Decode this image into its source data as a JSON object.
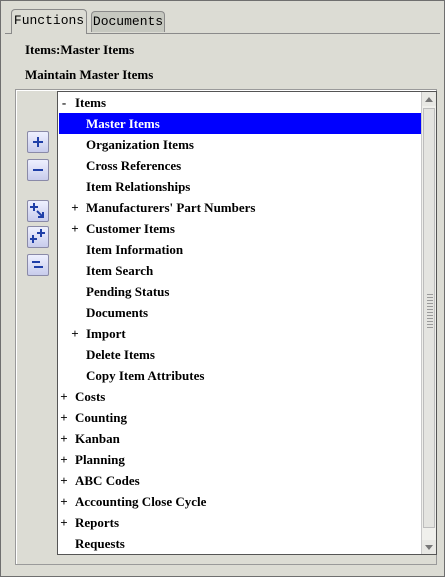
{
  "tabs": [
    {
      "label": "Functions",
      "active": true
    },
    {
      "label": "Documents",
      "active": false
    }
  ],
  "header": {
    "breadcrumb": "Items:Master Items",
    "subtitle": "Maintain Master Items"
  },
  "toolbar": {
    "expand_icon": "plus-icon",
    "collapse_icon": "minus-icon",
    "expand_branch_icon": "expand-branch-icon",
    "expand_all_icon": "expand-all-icon",
    "collapse_all_icon": "collapse-all-icon"
  },
  "tree": {
    "selected_color": "#0000ff",
    "nodes": [
      {
        "level": 0,
        "expander": "-",
        "label": "Items"
      },
      {
        "level": 1,
        "expander": "",
        "label": "Master Items",
        "selected": true
      },
      {
        "level": 1,
        "expander": "",
        "label": "Organization Items"
      },
      {
        "level": 1,
        "expander": "",
        "label": "Cross References"
      },
      {
        "level": 1,
        "expander": "",
        "label": "Item Relationships"
      },
      {
        "level": 1,
        "expander": "+",
        "label": "Manufacturers' Part Numbers"
      },
      {
        "level": 1,
        "expander": "+",
        "label": "Customer Items"
      },
      {
        "level": 1,
        "expander": "",
        "label": "Item Information"
      },
      {
        "level": 1,
        "expander": "",
        "label": "Item Search"
      },
      {
        "level": 1,
        "expander": "",
        "label": "Pending Status"
      },
      {
        "level": 1,
        "expander": "",
        "label": "Documents"
      },
      {
        "level": 1,
        "expander": "+",
        "label": "Import"
      },
      {
        "level": 1,
        "expander": "",
        "label": "Delete Items"
      },
      {
        "level": 1,
        "expander": "",
        "label": "Copy Item Attributes"
      },
      {
        "level": 0,
        "expander": "+",
        "label": "Costs"
      },
      {
        "level": 0,
        "expander": "+",
        "label": "Counting"
      },
      {
        "level": 0,
        "expander": "+",
        "label": "Kanban"
      },
      {
        "level": 0,
        "expander": "+",
        "label": "Planning"
      },
      {
        "level": 0,
        "expander": "+",
        "label": "ABC Codes"
      },
      {
        "level": 0,
        "expander": "+",
        "label": "Accounting Close Cycle"
      },
      {
        "level": 0,
        "expander": "+",
        "label": "Reports"
      },
      {
        "level": 0,
        "expander": "",
        "label": "Requests"
      }
    ]
  }
}
